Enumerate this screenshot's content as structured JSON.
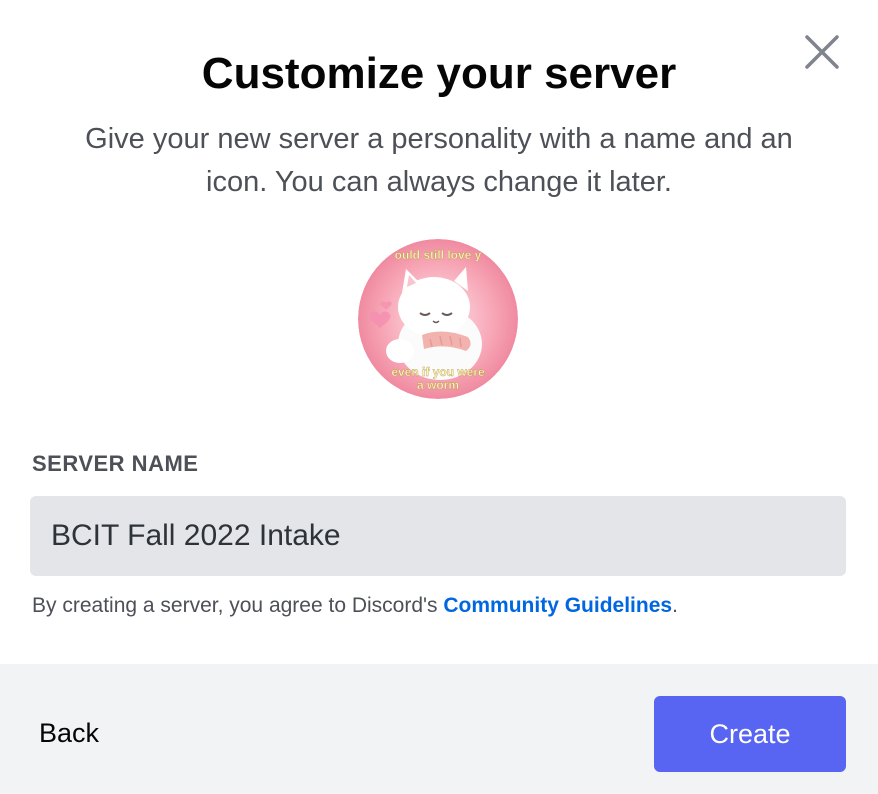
{
  "modal": {
    "title": "Customize your server",
    "subtitle": "Give your new server a personality with a name and an icon. You can always change it later.",
    "close_icon": "close-icon"
  },
  "server_icon": {
    "caption_top": "ould still love y",
    "caption_bottom_line1": "even if you were",
    "caption_bottom_line2": "a worm"
  },
  "form": {
    "server_name_label": "SERVER NAME",
    "server_name_value": "BCIT Fall 2022 Intake"
  },
  "terms": {
    "prefix": "By creating a server, you agree to Discord's ",
    "link_label": "Community Guidelines",
    "suffix": "."
  },
  "footer": {
    "back_label": "Back",
    "create_label": "Create"
  },
  "colors": {
    "accent": "#5865f2",
    "link": "#0067e0",
    "input_bg": "#e3e5e8",
    "footer_bg": "#f2f3f5"
  }
}
